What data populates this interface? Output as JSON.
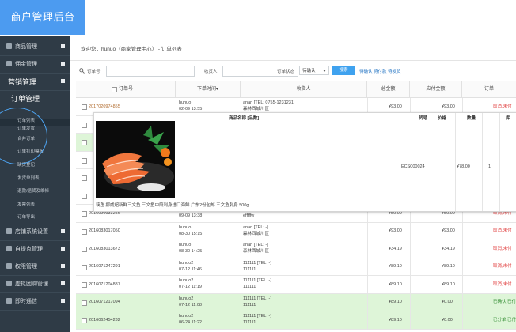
{
  "header": {
    "brand": "商户管理后台"
  },
  "sidebar": {
    "items": [
      {
        "label": "商品管理"
      },
      {
        "label": "佣金管理"
      },
      {
        "label": "营销管理"
      },
      {
        "label": "订单管理"
      },
      {
        "label": "店铺系统设置"
      },
      {
        "label": "自提点管理"
      },
      {
        "label": "权限管理"
      },
      {
        "label": "虚拟团购管理"
      },
      {
        "label": "即时通信"
      }
    ],
    "sub_items": [
      {
        "label": "订单列表"
      },
      {
        "label": "订单发货"
      },
      {
        "label": "合并订单"
      },
      {
        "label": "订单打印模板"
      },
      {
        "label": "缺货登记"
      },
      {
        "label": "发货单列表"
      },
      {
        "label": "退款/退货及维修"
      },
      {
        "label": "发票列表"
      },
      {
        "label": "订单导出"
      }
    ]
  },
  "breadcrumb": "欢迎您，hunuo（商家管理中心） - 订单列表",
  "search": {
    "order_no_label": "订单号",
    "receiver_label": "收货人",
    "status_label": "订单状态",
    "status_value": "待确认",
    "search_button": "搜索",
    "quick_links": "待确认 待付款 待发货"
  },
  "table": {
    "headers": [
      "订单号",
      "下单时间",
      "收货人",
      "总金额",
      "应付金额",
      "订单"
    ],
    "rows": [
      {
        "order_no": "2017020974855",
        "buyer": "hunuo",
        "time": "02-09 13:55",
        "receiver": "anan [TEL: 0755-1231231]",
        "receiver_addr": "森林西城川区",
        "total": "¥93.00",
        "payable": "¥93.00",
        "status": "取消,未付",
        "green": false
      },
      {
        "order_no": "",
        "buyer": "",
        "time": "",
        "receiver": "",
        "receiver_addr": "",
        "total": "",
        "payable": "",
        "status": "",
        "green": false
      },
      {
        "order_no": "",
        "buyer": "",
        "time": "",
        "receiver": "",
        "receiver_addr": "",
        "total": "",
        "payable": "",
        "status": "",
        "green": true
      },
      {
        "order_no": "",
        "buyer": "",
        "time": "",
        "receiver": "",
        "receiver_addr": "",
        "total": "",
        "payable": "",
        "status": "",
        "green": false
      },
      {
        "order_no": "",
        "buyer": "",
        "time": "",
        "receiver": "",
        "receiver_addr": "",
        "total": "",
        "payable": "",
        "status": "",
        "green": false
      },
      {
        "order_no": "",
        "buyer": "",
        "time": "",
        "receiver": "",
        "receiver_addr": "",
        "total": "",
        "payable": "",
        "status": "",
        "green": false
      },
      {
        "order_no": "2016090933256",
        "buyer": "hunuo",
        "time": "09-09 13:38",
        "receiver": "hedy [TEL: -]",
        "receiver_addr": "efffffw",
        "total": "¥50.00",
        "payable": "¥50.00",
        "status": "取消,未付",
        "green": false
      },
      {
        "order_no": "2016083017050",
        "buyer": "hunuo",
        "time": "08-30 15:15",
        "receiver": "anan [TEL: -]",
        "receiver_addr": "森林西城川区",
        "total": "¥93.00",
        "payable": "¥93.00",
        "status": "取消,未付",
        "green": false
      },
      {
        "order_no": "2016083013673",
        "buyer": "hunuo",
        "time": "08-30 14:25",
        "receiver": "anan [TEL: -]",
        "receiver_addr": "森林西城川区",
        "total": "¥34.19",
        "payable": "¥34.19",
        "status": "取消,未付",
        "green": false
      },
      {
        "order_no": "2016071247291",
        "buyer": "hunuo2",
        "time": "07-12 11:46",
        "receiver": "111111 [TEL: -]",
        "receiver_addr": "111111",
        "total": "¥89.10",
        "payable": "¥89.10",
        "status": "取消,未付",
        "green": false
      },
      {
        "order_no": "2016071204887",
        "buyer": "hunuo2",
        "time": "07-12 11:19",
        "receiver": "111111 [TEL: -]",
        "receiver_addr": "111111",
        "total": "¥89.10",
        "payable": "¥89.10",
        "status": "取消,未付",
        "green": false
      },
      {
        "order_no": "2016071217094",
        "buyer": "hunuo2",
        "time": "07-12 11:08",
        "receiver": "111111 [TEL: -]",
        "receiver_addr": "111111",
        "total": "¥89.10",
        "payable": "¥0.00",
        "status": "已确认,已付",
        "green": true
      },
      {
        "order_no": "2016062454232",
        "buyer": "hunuo2",
        "time": "06-24 11:22",
        "receiver": "111111 [TEL: -]",
        "receiver_addr": "111111",
        "total": "¥89.10",
        "payable": "¥0.00",
        "status": "已分单,已付",
        "green": true
      }
    ]
  },
  "popup": {
    "col_product": "商品名称 [品数]",
    "col_sku": "货号",
    "col_price": "价格",
    "col_qty": "数量",
    "col_extra": "库",
    "product_name": "筷鱼 挪威超新鲜三文鱼 三文鱼中段刺身进口海鲜 广东2份包邮 三文鱼刺身 500g",
    "sku": "ECS000024",
    "price": "¥78.00",
    "qty": "1"
  },
  "colors": {
    "brand": "#4c9bf0",
    "sidebar": "#2f3b46",
    "status_red": "#e03c3c",
    "status_green": "#2f8a2f",
    "row_green": "#def5d8",
    "link": "#2a78c5"
  }
}
